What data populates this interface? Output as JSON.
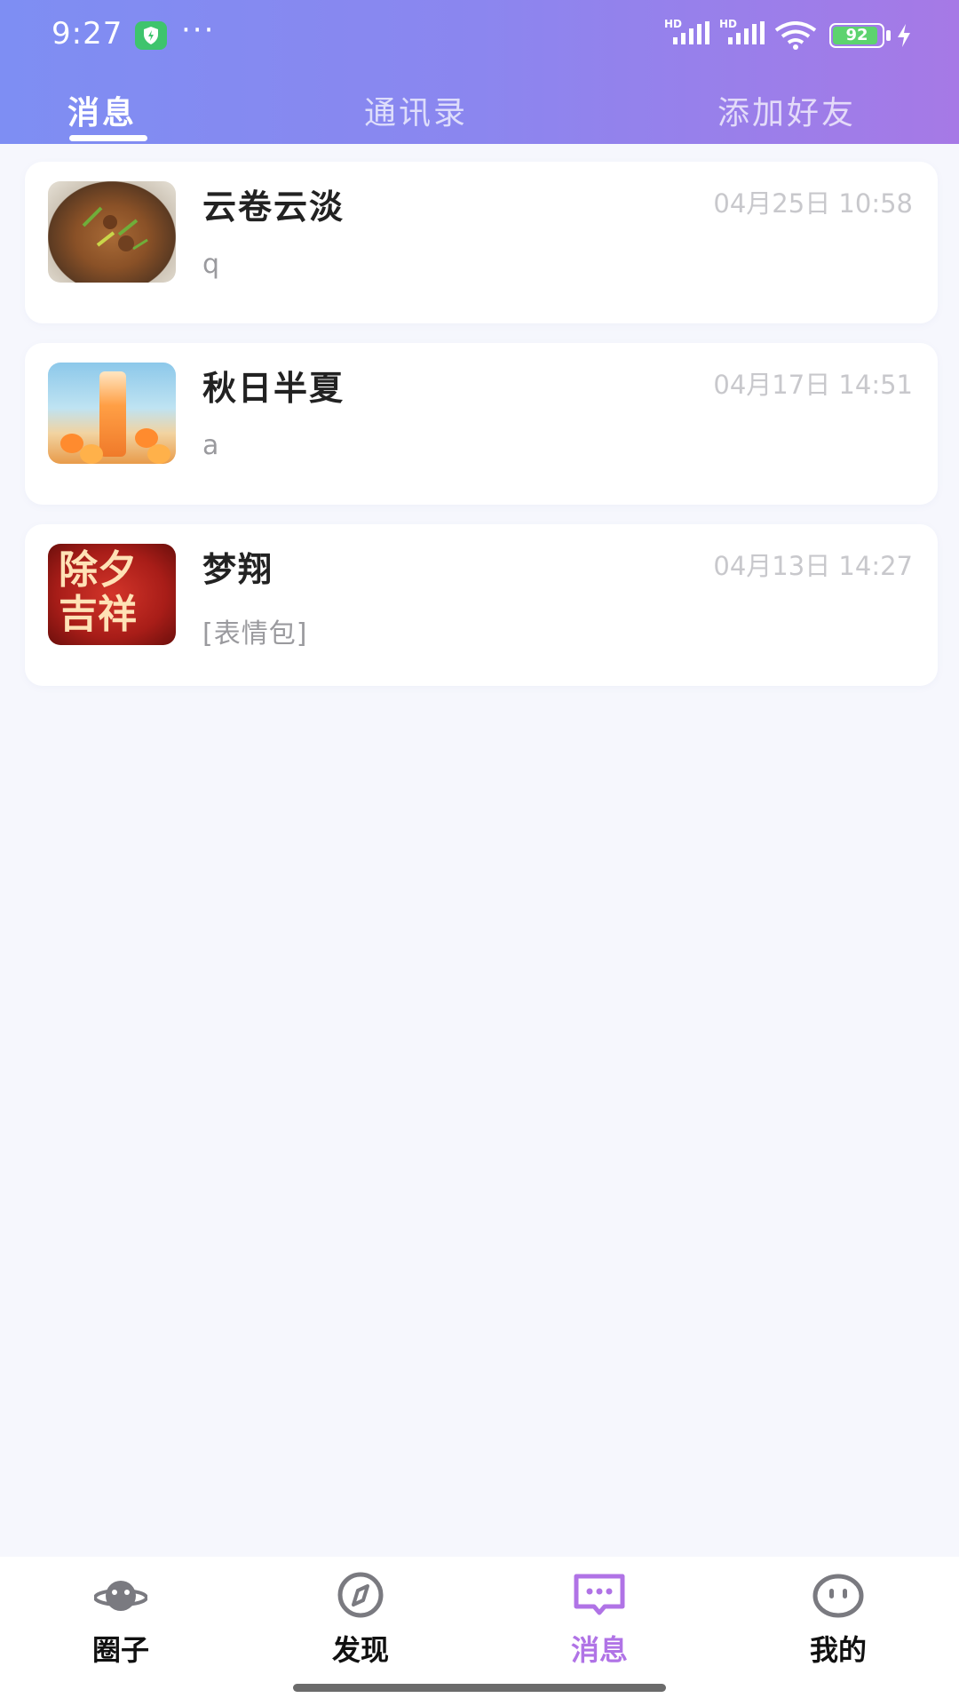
{
  "status_bar": {
    "time": "9:27",
    "battery_level": "92",
    "icons": [
      "shield-icon",
      "more-dots-icon",
      "hd-signal-icon",
      "hd-signal-icon",
      "wifi-icon",
      "battery-icon",
      "charging-icon"
    ]
  },
  "top_tabs": [
    {
      "label": "消息",
      "active": true
    },
    {
      "label": "通讯录",
      "active": false
    },
    {
      "label": "添加好友",
      "active": false
    }
  ],
  "chats": [
    {
      "name": "云卷云淡",
      "time": "04月25日 10:58",
      "preview": "q",
      "avatar": "food-photo"
    },
    {
      "name": "秋日半夏",
      "time": "04月17日 14:51",
      "preview": "a",
      "avatar": "drink-bottle-image"
    },
    {
      "name": "梦翔",
      "time": "04月13日 14:27",
      "preview": "[表情包]",
      "avatar": "new-year-greeting-image",
      "avatar_text": [
        "除夕",
        "吉祥"
      ]
    }
  ],
  "bottom_nav": [
    {
      "label": "圈子",
      "icon": "planet-icon",
      "active": false
    },
    {
      "label": "发现",
      "icon": "compass-icon",
      "active": false
    },
    {
      "label": "消息",
      "icon": "message-icon",
      "active": true
    },
    {
      "label": "我的",
      "icon": "face-icon",
      "active": false
    }
  ],
  "colors": {
    "header_gradient_start": "#7e8ef3",
    "header_gradient_end": "#a679e6",
    "active_nav": "#b073e6",
    "background": "#f6f7fd"
  }
}
